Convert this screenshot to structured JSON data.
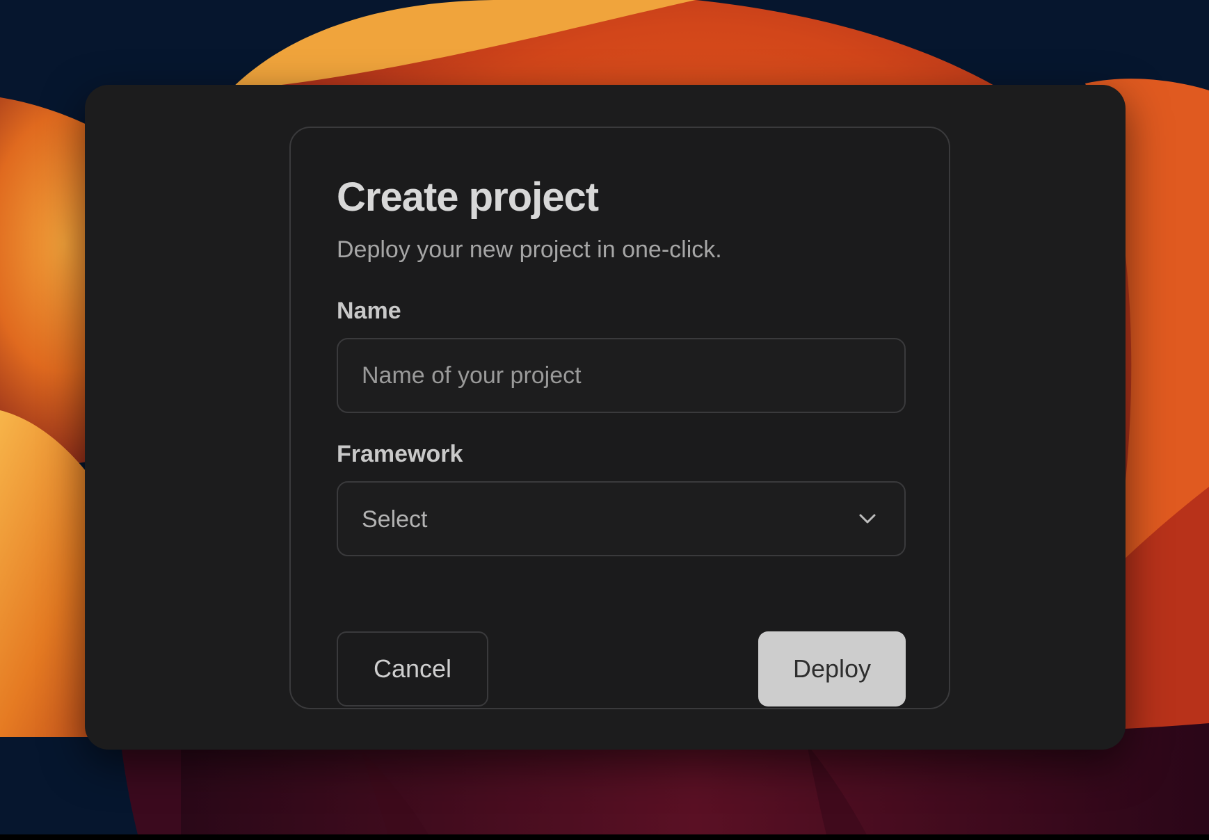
{
  "dialog": {
    "title": "Create project",
    "subtitle": "Deploy your new project in one-click.",
    "name_label": "Name",
    "name_placeholder": "Name of your project",
    "name_value": "",
    "framework_label": "Framework",
    "framework_selected": "Select",
    "cancel_label": "Cancel",
    "deploy_label": "Deploy"
  },
  "icons": {
    "dropdown": "chevron-down-icon"
  },
  "colors": {
    "window_bg": "#1c1c1d",
    "card_border": "#3a3a3c",
    "primary_button": "#cdcdcd",
    "wallpaper_orange": "#e8621f",
    "wallpaper_navy": "#06162e"
  }
}
